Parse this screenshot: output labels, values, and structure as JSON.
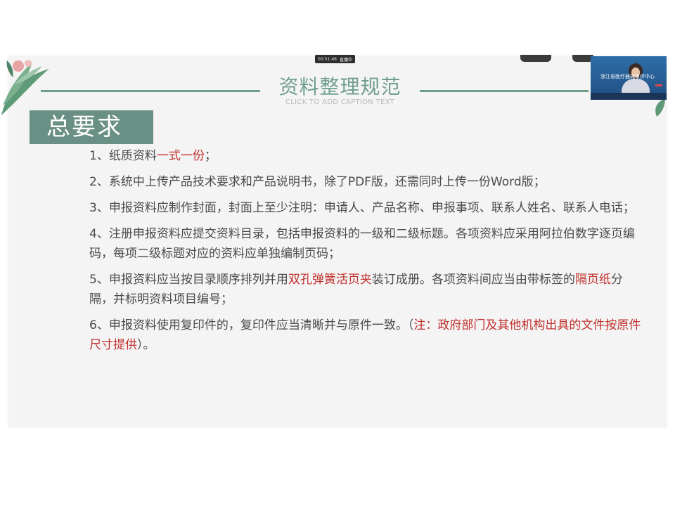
{
  "meeting": {
    "timer": "00:51:46",
    "live_badge": "直播中",
    "speaker_org": "浙江省医疗器械审评中心"
  },
  "slide": {
    "title": "资料整理规范",
    "caption": "CLICK TO ADD CAPTION TEXT",
    "section_tag": "总要求",
    "items": [
      [
        {
          "text": "1、纸质资料"
        },
        {
          "text": "一式一份",
          "hl": true
        },
        {
          "text": "；"
        }
      ],
      [
        {
          "text": "2、系统中上传产品技术要求和产品说明书，除了PDF版，还需同时上传一份Word版；"
        }
      ],
      [
        {
          "text": "3、申报资料应制作封面，封面上至少注明：申请人、产品名称、申报事项、联系人姓名、联系人电话；"
        }
      ],
      [
        {
          "text": "4、注册申报资料应提交资料目录，包括申报资料的一级和二级标题。各项资料应采用阿拉伯数字逐页编码，每项二级标题对应的资料应单独编制页码；"
        }
      ],
      [
        {
          "text": "5、申报资料应当按目录顺序排列并用"
        },
        {
          "text": "双孔弹簧活页夹",
          "hl": true
        },
        {
          "text": "装订成册。各项资料间应当由带标签的"
        },
        {
          "text": "隔页纸",
          "hl": true
        },
        {
          "text": "分隔，并标明资料项目编号；"
        }
      ],
      [
        {
          "text": "6、申报资料使用复印件的，复印件应当清晰并与原件一致。（"
        },
        {
          "text": "注：政府部门及其他机构出具的文件按原件尺寸提供",
          "hl": true
        },
        {
          "text": "）。"
        }
      ]
    ]
  },
  "colors": {
    "accent": "#6f9e8b",
    "tag_bg": "#6a8f84",
    "highlight": "#c0302d",
    "body_text": "#4a4a4a"
  },
  "icons": [
    "tropical-leaves-decoration",
    "leaf-decoration"
  ]
}
